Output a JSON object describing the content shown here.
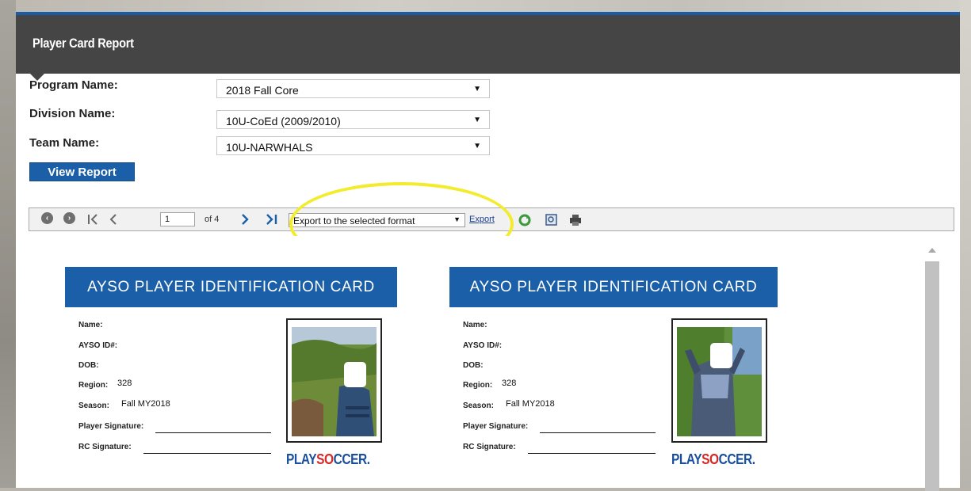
{
  "header": {
    "title": "Player Card Report"
  },
  "form": {
    "program": {
      "label": "Program Name:",
      "value": "2018 Fall Core"
    },
    "division": {
      "label": "Division Name:",
      "value": "10U-CoEd (2009/2010)"
    },
    "team": {
      "label": "Team Name:",
      "value": "10U-NARWHALS"
    },
    "view_button": "View Report",
    "dropdown_arrow": "▼"
  },
  "toolbar": {
    "icons": [
      "back-icon",
      "forward-icon",
      "first-page-icon",
      "previous-page-icon",
      "next-page-icon",
      "last-page-icon",
      "refresh-icon",
      "print-preview-icon",
      "print-icon"
    ],
    "page_value": "1",
    "page_of": "of 4",
    "export_format": "Export to the selected format",
    "export_link": "Export",
    "highlight_color": "#f2ec2c"
  },
  "cards": [
    {
      "banner": "AYSO PLAYER IDENTIFICATION CARD",
      "name_label": "Name:",
      "id_label": "AYSO ID#:",
      "dob_label": "DOB:",
      "region_label": "Region:",
      "region_value": "328",
      "season_label": "Season:",
      "season_value": "Fall MY2018",
      "player_sig_label": "Player Signature:",
      "rc_sig_label": "RC Signature:",
      "logo": {
        "part1": "PLAY",
        "part2": "SO",
        "part3": "CCER."
      }
    },
    {
      "banner": "AYSO PLAYER IDENTIFICATION CARD",
      "name_label": "Name:",
      "id_label": "AYSO ID#:",
      "dob_label": "DOB:",
      "region_label": "Region:",
      "region_value": "328",
      "season_label": "Season:",
      "season_value": "Fall MY2018",
      "player_sig_label": "Player Signature:",
      "rc_sig_label": "RC Signature:",
      "logo": {
        "part1": "PLAY",
        "part2": "SO",
        "part3": "CCER."
      }
    }
  ],
  "colors": {
    "header_bg": "#454545",
    "accent_blue": "#1a5fa8",
    "logo_red": "#d42a27"
  }
}
